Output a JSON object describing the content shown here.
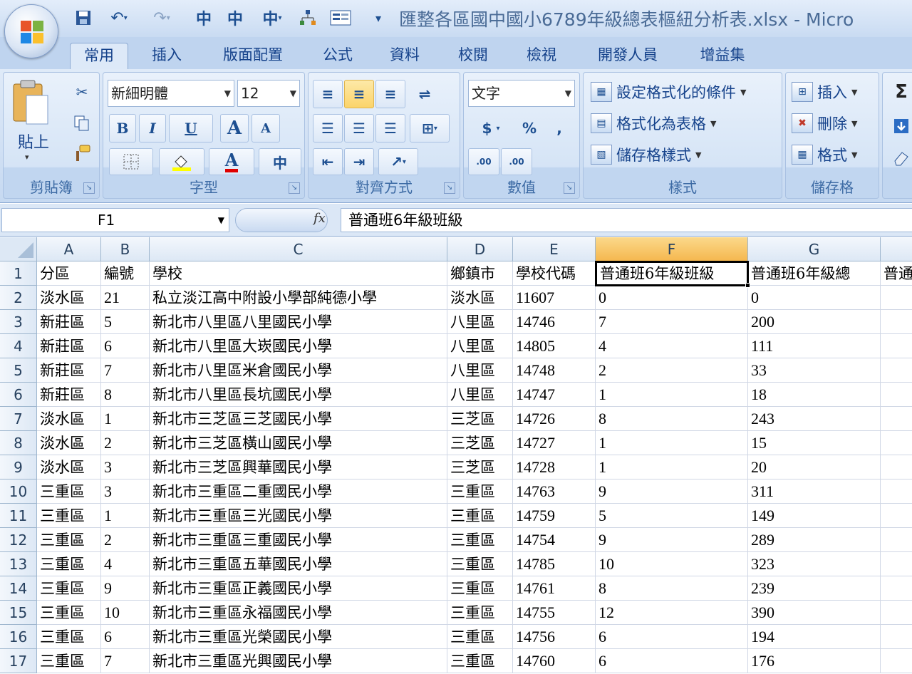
{
  "window": {
    "title": "匯整各區國中國小6789年級總表樞紐分析表.xlsx - Micro"
  },
  "tabs": [
    {
      "label": "常用",
      "active": true
    },
    {
      "label": "插入",
      "active": false
    },
    {
      "label": "版面配置",
      "active": false
    },
    {
      "label": "公式",
      "active": false
    },
    {
      "label": "資料",
      "active": false
    },
    {
      "label": "校閱",
      "active": false
    },
    {
      "label": "檢視",
      "active": false
    },
    {
      "label": "開發人員",
      "active": false
    },
    {
      "label": "增益集",
      "active": false
    }
  ],
  "ribbon": {
    "clipboard": {
      "label": "剪貼簿",
      "paste_label": "貼上"
    },
    "font": {
      "label": "字型",
      "font_name": "新細明體",
      "font_size": "12",
      "bold": "B",
      "italic": "I",
      "underline": "U",
      "grow": "A",
      "shrink": "A",
      "font_color": "A",
      "phonetic": "中"
    },
    "alignment": {
      "label": "對齊方式"
    },
    "number": {
      "label": "數值",
      "format": "文字",
      "currency": "$",
      "percent": "%",
      "comma": ",",
      "inc_decimal": ".00",
      "dec_decimal": ".00"
    },
    "styles": {
      "label": "樣式",
      "conditional": "設定格式化的條件",
      "as_table": "格式化為表格",
      "cell_styles": "儲存格樣式"
    },
    "cells": {
      "label": "儲存格",
      "insert": "插入",
      "delete": "刪除",
      "format": "格式"
    },
    "editing": {
      "sigma": "Σ"
    }
  },
  "formula_bar": {
    "name_box": "F1",
    "fx": "fx",
    "formula": "普通班6年級班級"
  },
  "sheet": {
    "selected_cell": "F1",
    "columns": [
      "A",
      "B",
      "C",
      "D",
      "E",
      "F",
      "G",
      ""
    ],
    "rows": [
      {
        "n": "1",
        "cells": [
          "分區",
          "編號",
          "學校",
          "鄉鎮市",
          "學校代碼",
          "普通班6年級班級",
          "普通班6年級總",
          "普通"
        ]
      },
      {
        "n": "2",
        "cells": [
          "淡水區",
          "21",
          "私立淡江高中附設小學部純德小學",
          "淡水區",
          "11607",
          "0",
          "0",
          ""
        ]
      },
      {
        "n": "3",
        "cells": [
          "新莊區",
          "5",
          "新北市八里區八里國民小學",
          "八里區",
          "14746",
          "7",
          "200",
          ""
        ]
      },
      {
        "n": "4",
        "cells": [
          "新莊區",
          "6",
          "新北市八里區大崁國民小學",
          "八里區",
          "14805",
          "4",
          "111",
          ""
        ]
      },
      {
        "n": "5",
        "cells": [
          "新莊區",
          "7",
          "新北市八里區米倉國民小學",
          "八里區",
          "14748",
          "2",
          "33",
          ""
        ]
      },
      {
        "n": "6",
        "cells": [
          "新莊區",
          "8",
          "新北市八里區長坑國民小學",
          "八里區",
          "14747",
          "1",
          "18",
          ""
        ]
      },
      {
        "n": "7",
        "cells": [
          "淡水區",
          "1",
          "新北市三芝區三芝國民小學",
          "三芝區",
          "14726",
          "8",
          "243",
          ""
        ]
      },
      {
        "n": "8",
        "cells": [
          "淡水區",
          "2",
          "新北市三芝區橫山國民小學",
          "三芝區",
          "14727",
          "1",
          "15",
          ""
        ]
      },
      {
        "n": "9",
        "cells": [
          "淡水區",
          "3",
          "新北市三芝區興華國民小學",
          "三芝區",
          "14728",
          "1",
          "20",
          ""
        ]
      },
      {
        "n": "10",
        "cells": [
          "三重區",
          "3",
          "新北市三重區二重國民小學",
          "三重區",
          "14763",
          "9",
          "311",
          ""
        ]
      },
      {
        "n": "11",
        "cells": [
          "三重區",
          "1",
          "新北市三重區三光國民小學",
          "三重區",
          "14759",
          "5",
          "149",
          ""
        ]
      },
      {
        "n": "12",
        "cells": [
          "三重區",
          "2",
          "新北市三重區三重國民小學",
          "三重區",
          "14754",
          "9",
          "289",
          ""
        ]
      },
      {
        "n": "13",
        "cells": [
          "三重區",
          "4",
          "新北市三重區五華國民小學",
          "三重區",
          "14785",
          "10",
          "323",
          ""
        ]
      },
      {
        "n": "14",
        "cells": [
          "三重區",
          "9",
          "新北市三重區正義國民小學",
          "三重區",
          "14761",
          "8",
          "239",
          ""
        ]
      },
      {
        "n": "15",
        "cells": [
          "三重區",
          "10",
          "新北市三重區永福國民小學",
          "三重區",
          "14755",
          "12",
          "390",
          ""
        ]
      },
      {
        "n": "16",
        "cells": [
          "三重區",
          "6",
          "新北市三重區光榮國民小學",
          "三重區",
          "14756",
          "6",
          "194",
          ""
        ]
      },
      {
        "n": "17",
        "cells": [
          "三重區",
          "7",
          "新北市三重區光興國民小學",
          "三重區",
          "14760",
          "6",
          "176",
          ""
        ]
      }
    ]
  }
}
